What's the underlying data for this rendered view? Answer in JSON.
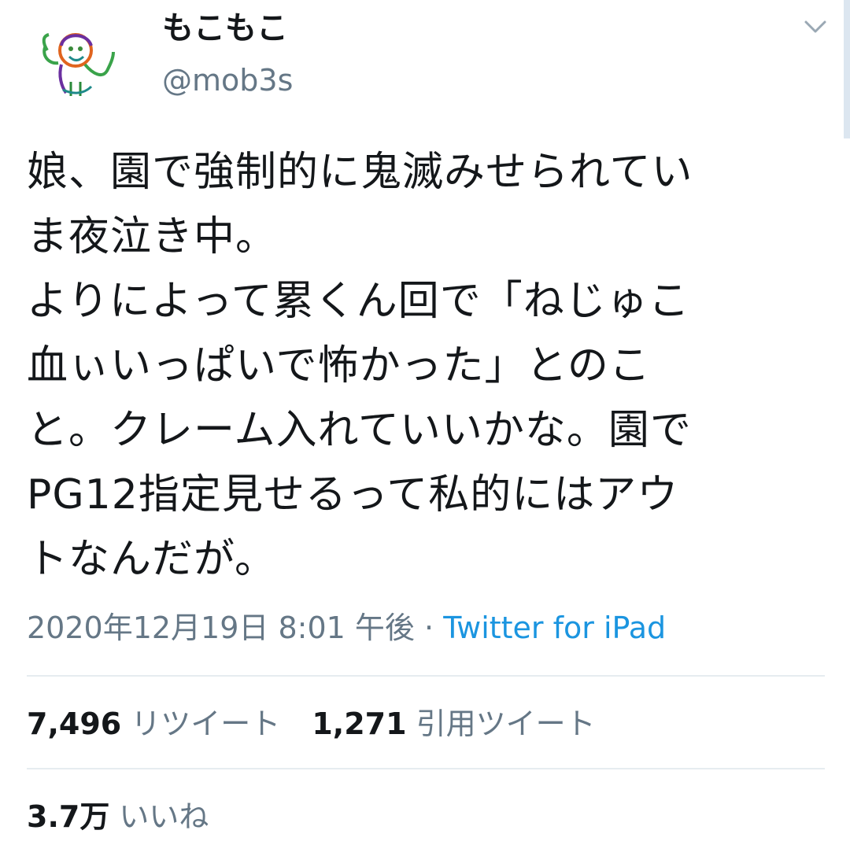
{
  "header": {
    "display_name": "もこもこ",
    "handle": "@mob3s",
    "avatar": "hand-drawn-figure",
    "menu_icon": "chevron-down-icon"
  },
  "tweet": {
    "text": "娘、園で強制的に鬼滅みせられてい\nま夜泣き中。\nよりによって累くん回で「ねじゅこ\n血ぃいっぱいで怖かった」とのこ\nと。クレーム入れていいかな。園で\nPG12指定見せるって私的にはアウ\nトなんだが。",
    "timestamp": "2020年12月19日 8:01 午後",
    "separator": "·",
    "source": "Twitter for iPad"
  },
  "stats": {
    "retweets": "7,496",
    "retweets_label": "リツイート",
    "quotes": "1,271",
    "quotes_label": "引用ツイート",
    "likes": "3.7万",
    "likes_label": "いいね"
  },
  "colors": {
    "text": "#14171a",
    "secondary": "#657786",
    "link": "#1b95e0",
    "divider": "#e6ecf0"
  }
}
